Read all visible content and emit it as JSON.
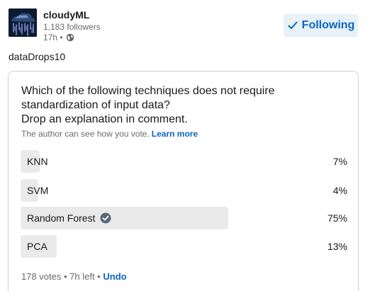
{
  "author": {
    "name": "cloudyML",
    "followers": "1,183 followers",
    "time": "17h •",
    "avatar_icon": "cloudyml-logo",
    "visibility_icon": "globe-icon"
  },
  "follow_button": {
    "label": "Following",
    "icon": "check-icon",
    "color": "#0a66c2",
    "background": "#e8f0f8"
  },
  "post": {
    "text": "dataDrops10"
  },
  "poll": {
    "question": "Which of the following techniques does not require\nstandardization of input data?\nDrop an explanation in comment.",
    "notice": "The author can see how you vote.",
    "learn_more": "Learn more",
    "options": [
      {
        "label": "KNN",
        "percent": "7%",
        "value": 7,
        "selected": false
      },
      {
        "label": "SVM",
        "percent": "4%",
        "value": 4,
        "selected": false
      },
      {
        "label": "Random Forest",
        "percent": "75%",
        "value": 75,
        "selected": true
      },
      {
        "label": "PCA",
        "percent": "13%",
        "value": 13,
        "selected": false
      }
    ],
    "footer_stats": "178 votes • 7h left •",
    "undo": "Undo",
    "accent_color": "#0a66c2",
    "bar_color": "#eaeaea"
  }
}
